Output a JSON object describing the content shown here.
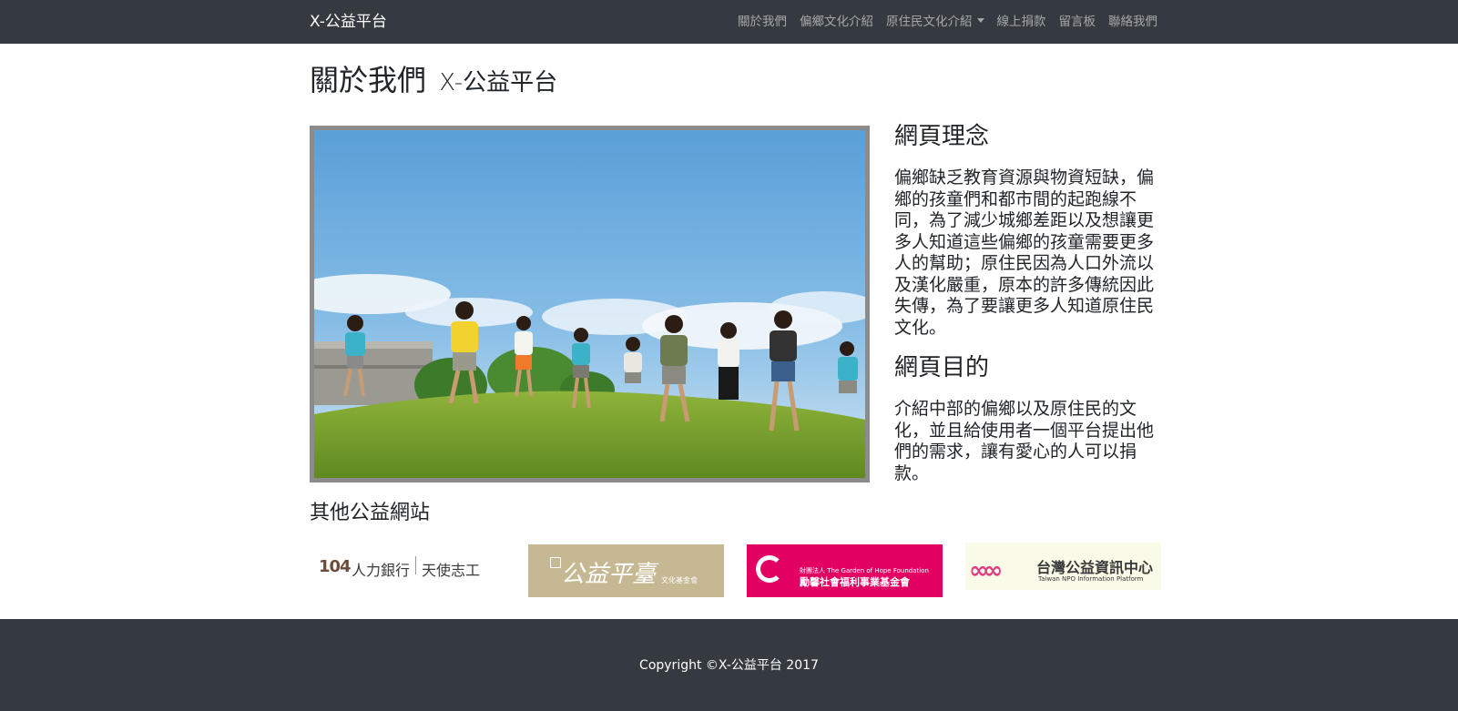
{
  "navbar": {
    "brand": "X-公益平台",
    "items": [
      {
        "label": "關於我們"
      },
      {
        "label": "偏鄉文化介紹"
      },
      {
        "label": "原住民文化介紹",
        "dropdown": true
      },
      {
        "label": "線上捐款"
      },
      {
        "label": "留言板"
      },
      {
        "label": "聯絡我們"
      }
    ]
  },
  "page": {
    "title": "關於我們",
    "subtitle": "X-公益平台"
  },
  "about": {
    "philosophy_heading": "網頁理念",
    "philosophy_text": "偏鄉缺乏教育資源與物資短缺，偏鄉的孩童們和都市間的起跑線不同，為了減少城鄉差距以及想讓更多人知道這些偏鄉的孩童需要更多人的幫助；原住民因為人口外流以及漢化嚴重，原本的許多傳統因此失傳，為了要讓更多人知道原住民文化。",
    "purpose_heading": "網頁目的",
    "purpose_text": "介紹中部的偏鄉以及原住民的文化，並且給使用者一個平台提出他們的需求，讓有愛心的人可以捐款。"
  },
  "partners": {
    "heading": "其他公益網站",
    "logos": [
      {
        "name": "104人力銀行 天使志工",
        "text_a": "104",
        "text_b": "人力銀行",
        "text_c": "天使志工"
      },
      {
        "name": "公益平臺文化基金會",
        "text_a": "公益平臺",
        "text_b": "文化基金會"
      },
      {
        "name": "財團法人勵馨社會福利事業基金會",
        "text_a": "財團法人 The Garden of Hope Foundation",
        "text_b": "勵馨社會福利事業基金會"
      },
      {
        "name": "台灣公益資訊中心",
        "text_a": "台灣公益資訊中心",
        "text_b": "Taiwan NPO Information Platform"
      }
    ]
  },
  "footer": {
    "copyright": "Copyright ©X-公益平台 2017"
  },
  "colors": {
    "navbar_bg": "#343a40",
    "footer_bg": "#343a40",
    "nav_link": "rgba(255,255,255,0.55)"
  }
}
